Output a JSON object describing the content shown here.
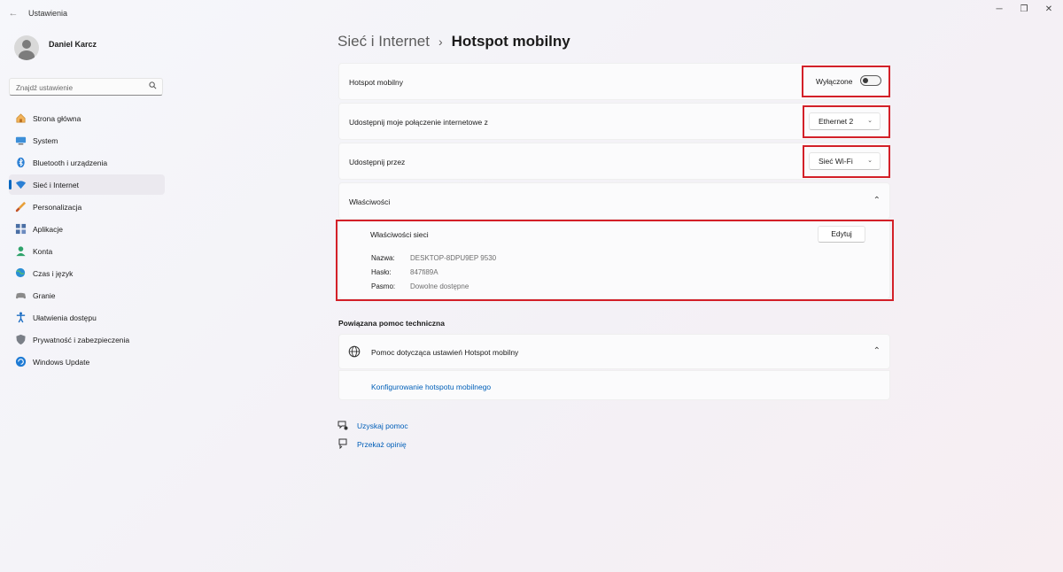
{
  "window": {
    "title": "Ustawienia",
    "back_glyph": "←",
    "minimize_glyph": "─",
    "maximize_glyph": "❐",
    "close_glyph": "✕"
  },
  "profile": {
    "name": "Daniel Karcz"
  },
  "search": {
    "placeholder": "Znajdź ustawienie",
    "icon": "search-icon"
  },
  "sidebar": {
    "items": [
      {
        "label": "Strona główna",
        "icon": "home-icon"
      },
      {
        "label": "System",
        "icon": "monitor-icon"
      },
      {
        "label": "Bluetooth i urządzenia",
        "icon": "bluetooth-icon"
      },
      {
        "label": "Sieć i Internet",
        "icon": "wifi-icon",
        "active": true
      },
      {
        "label": "Personalizacja",
        "icon": "brush-icon"
      },
      {
        "label": "Aplikacje",
        "icon": "apps-icon"
      },
      {
        "label": "Konta",
        "icon": "person-icon"
      },
      {
        "label": "Czas i język",
        "icon": "globe-clock-icon"
      },
      {
        "label": "Granie",
        "icon": "gamepad-icon"
      },
      {
        "label": "Ułatwienia dostępu",
        "icon": "accessibility-icon"
      },
      {
        "label": "Prywatność i zabezpieczenia",
        "icon": "shield-icon"
      },
      {
        "label": "Windows Update",
        "icon": "update-icon"
      }
    ]
  },
  "breadcrumb": {
    "parent": "Sieć i Internet",
    "separator": "›",
    "current": "Hotspot mobilny"
  },
  "hotspot": {
    "label": "Hotspot mobilny",
    "toggle_text": "Wyłączone",
    "toggle_on": false
  },
  "share_from": {
    "label": "Udostępnij moje połączenie internetowe z",
    "value": "Ethernet 2"
  },
  "share_over": {
    "label": "Udostępnij przez",
    "value": "Sieć Wi-Fi"
  },
  "properties": {
    "header": "Właściwości",
    "expanded": true,
    "chevron": "⌃",
    "title": "Właściwości sieci",
    "edit_label": "Edytuj",
    "rows": [
      {
        "key": "Nazwa:",
        "value": "DESKTOP-8DPU9EP 9530"
      },
      {
        "key": "Hasło:",
        "value": "847fi89A"
      },
      {
        "key": "Pasmo:",
        "value": "Dowolne dostępne"
      }
    ]
  },
  "related": {
    "title": "Powiązana pomoc techniczna",
    "help_label": "Pomoc dotycząca ustawień Hotspot mobilny",
    "chevron": "⌃",
    "link": "Konfigurowanie hotspotu mobilnego"
  },
  "footer": {
    "get_help": "Uzyskaj pomoc",
    "feedback": "Przekaż opinię"
  },
  "colors": {
    "accent": "#0067c0",
    "link": "#005fb8",
    "highlight_box": "#d32028"
  }
}
